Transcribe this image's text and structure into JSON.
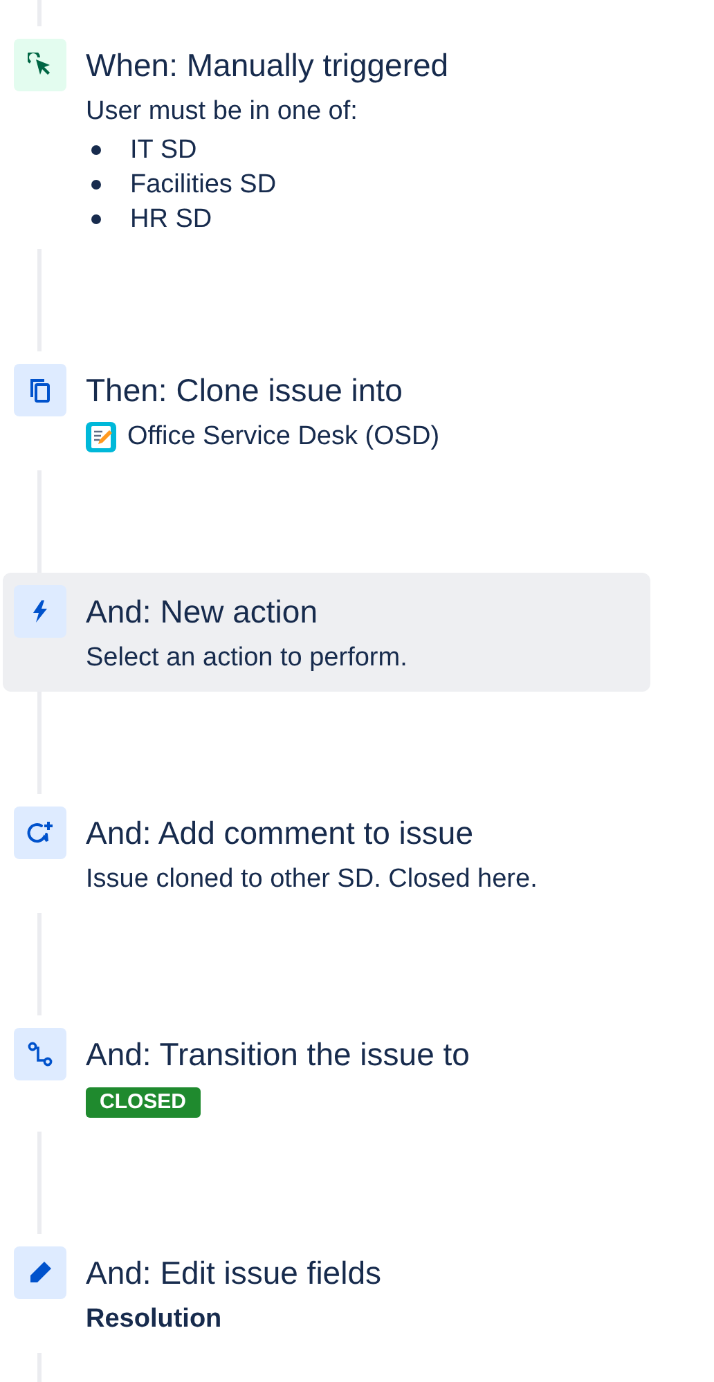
{
  "steps": [
    {
      "kind": "trigger",
      "title": "When: Manually triggered",
      "selected": false,
      "details": [
        {
          "kind": "text",
          "text": "User must be in one of:"
        },
        {
          "kind": "list",
          "items": [
            "IT SD",
            "Facilities SD",
            "HR SD"
          ]
        }
      ]
    },
    {
      "kind": "clone",
      "title": "Then: Clone issue into",
      "selected": false,
      "details": [
        {
          "kind": "project",
          "text": "Office Service Desk (OSD)"
        }
      ]
    },
    {
      "kind": "action",
      "title": "And: New action",
      "selected": true,
      "details": [
        {
          "kind": "text",
          "text": "Select an action to perform."
        }
      ]
    },
    {
      "kind": "comment",
      "title": "And: Add comment to issue",
      "selected": false,
      "details": [
        {
          "kind": "text",
          "text": "Issue cloned to other SD. Closed here."
        }
      ]
    },
    {
      "kind": "transition",
      "title": "And: Transition the issue to",
      "selected": false,
      "details": [
        {
          "kind": "status",
          "text": "CLOSED"
        }
      ]
    },
    {
      "kind": "edit",
      "title": "And: Edit issue fields",
      "selected": false,
      "details": [
        {
          "kind": "field",
          "text": "Resolution"
        }
      ]
    }
  ]
}
